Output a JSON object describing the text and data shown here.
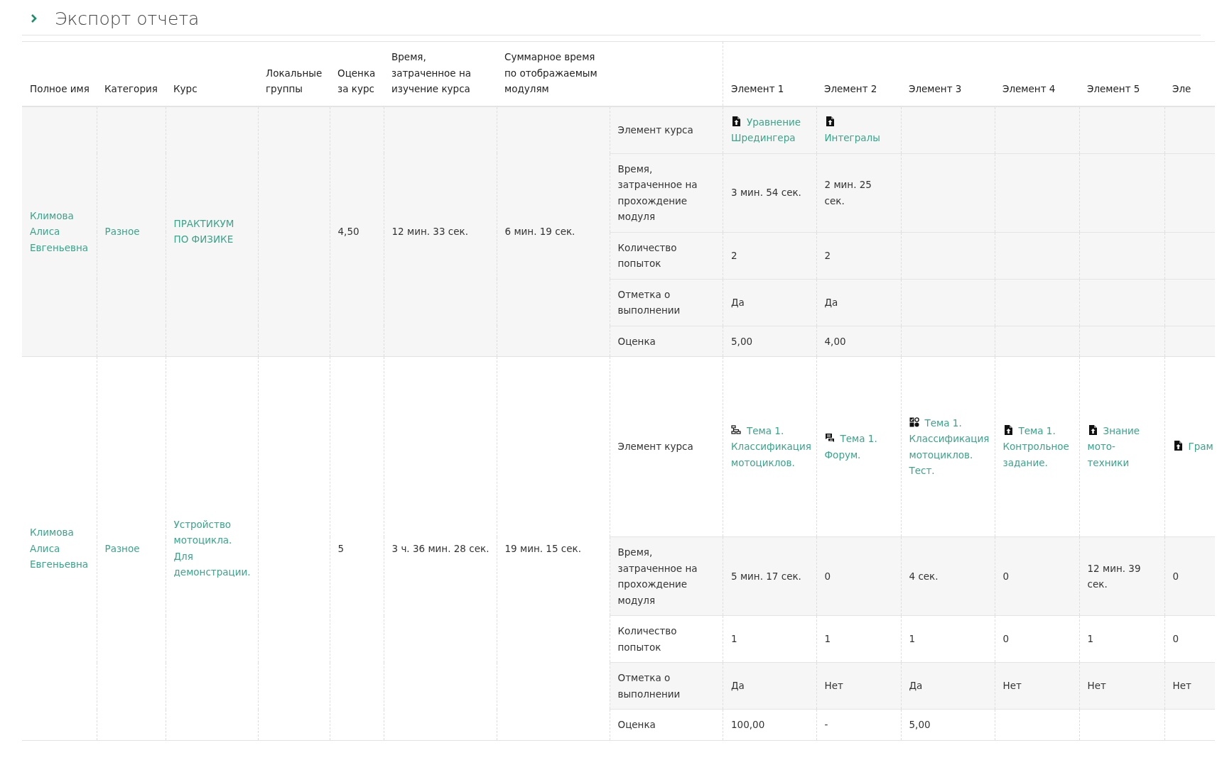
{
  "title": "Экспорт отчета",
  "table": {
    "columns": [
      "Полное имя",
      "Категория",
      "Курс",
      "Локальные группы",
      "Оценка за курс",
      "Время, затраченное на изучение курса",
      "Суммарное время по отображаемым модулям"
    ],
    "element_columns": [
      "Элемент 1",
      "Элемент 2",
      "Элемент 3",
      "Элемент 4",
      "Элемент 5",
      "Эле"
    ],
    "records": [
      {
        "full_name": "Климова Алиса Евгеньевна",
        "category": "Разное",
        "course": "ПРАКТИКУМ ПО ФИЗИКЕ",
        "course_grade": "4,50",
        "time_spent": "12 мин. 33 сек.",
        "total_module_time": "6 мин. 19 сек.",
        "element_label": "Элемент курса",
        "elements": [
          {
            "kind": "file",
            "title": "Уравнение Шредингера"
          },
          {
            "kind": "file",
            "title": "Интегралы"
          }
        ],
        "metrics": [
          {
            "label": "Время, затраченное на прохождение модуля",
            "values": [
              "3 мин. 54 сек.",
              "2 мин. 25 сек."
            ]
          },
          {
            "label": "Количество попыток",
            "values": [
              "2",
              "2"
            ]
          },
          {
            "label": "Отметка о выполнении",
            "values": [
              "Да",
              "Да"
            ]
          },
          {
            "label": "Оценка",
            "values": [
              "5,00",
              "4,00"
            ]
          }
        ]
      },
      {
        "full_name": "Климова Алиса Евгеньевна",
        "category": "Разное",
        "course": "Устройство мотоцикла. Для демонстрации.",
        "course_grade": "5",
        "time_spent": "3 ч. 36 мин. 28 сек.",
        "total_module_time": "19 мин. 15 сек.",
        "element_label": "Элемент курса",
        "elements": [
          {
            "kind": "structure",
            "title": "Тема 1. Классификация мотоциклов."
          },
          {
            "kind": "forum",
            "title": "Тема 1. Форум."
          },
          {
            "kind": "quiz",
            "title": "Тема 1. Классификация мотоциклов. Тест."
          },
          {
            "kind": "file",
            "title": "Тема 1. Контрольное задание."
          },
          {
            "kind": "file",
            "title": "Знание мото-техники"
          },
          {
            "kind": "file",
            "title": "Грам"
          }
        ],
        "metrics": [
          {
            "label": "Время, затраченное на прохождение модуля",
            "values": [
              "5 мин. 17 сек.",
              "0",
              "4 сек.",
              "0",
              "12 мин. 39 сек.",
              "0"
            ]
          },
          {
            "label": "Количество попыток",
            "values": [
              "1",
              "1",
              "1",
              "0",
              "1",
              "0"
            ]
          },
          {
            "label": "Отметка о выполнении",
            "values": [
              "Да",
              "Нет",
              "Да",
              "Нет",
              "Нет",
              "Нет"
            ]
          },
          {
            "label": "Оценка",
            "values": [
              "100,00",
              "-",
              "5,00"
            ]
          }
        ]
      }
    ]
  }
}
